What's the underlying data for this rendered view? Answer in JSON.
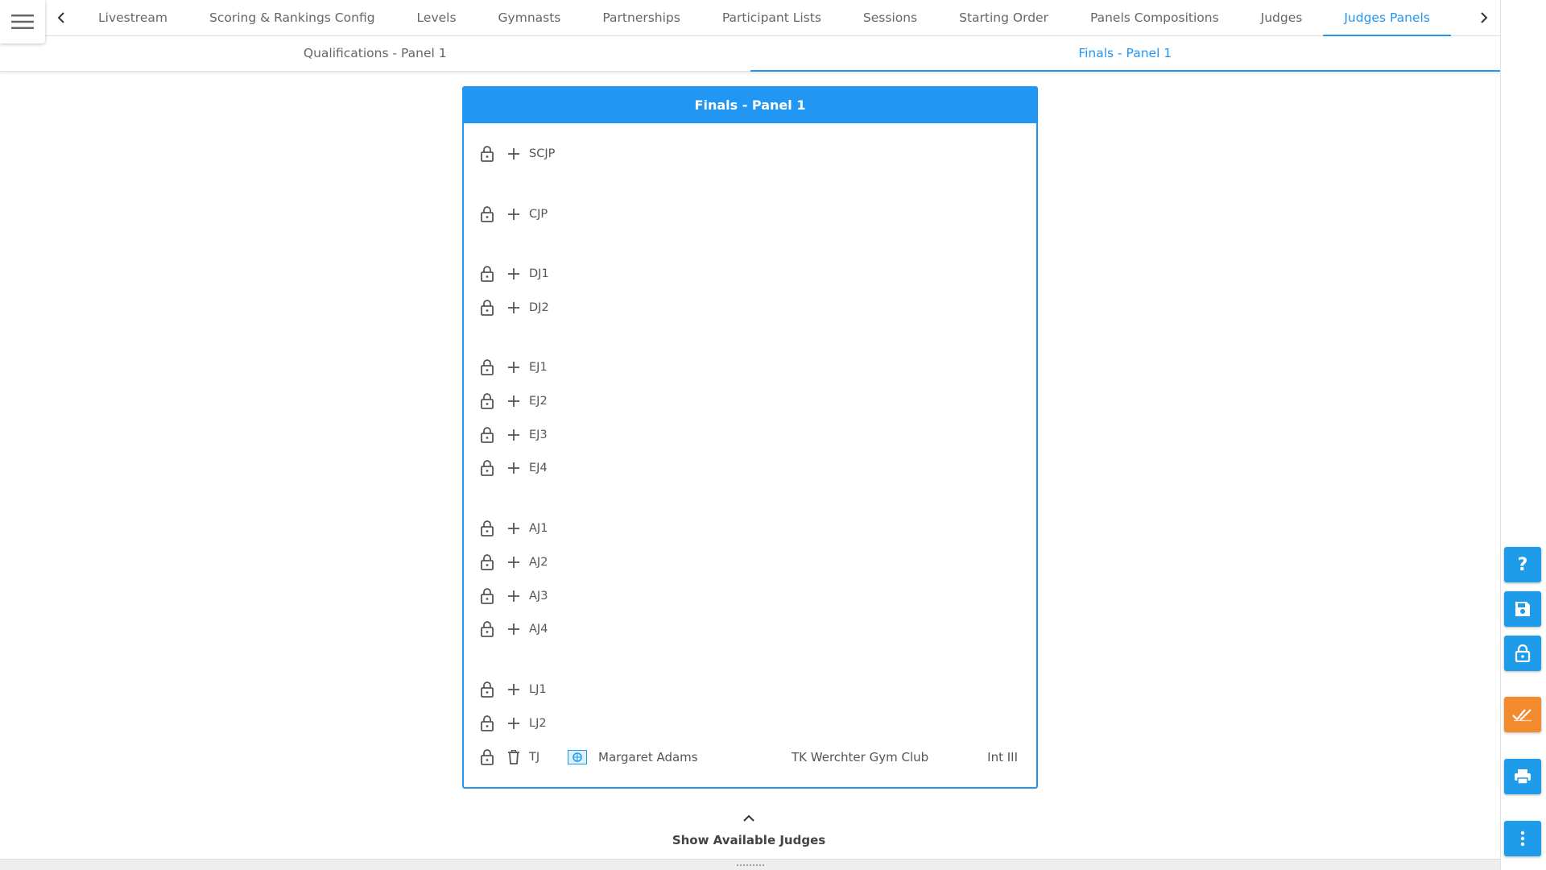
{
  "nav": {
    "tabs": [
      {
        "label": "Livestream"
      },
      {
        "label": "Scoring & Rankings Config"
      },
      {
        "label": "Levels"
      },
      {
        "label": "Gymnasts"
      },
      {
        "label": "Partnerships"
      },
      {
        "label": "Participant Lists"
      },
      {
        "label": "Sessions"
      },
      {
        "label": "Starting Order"
      },
      {
        "label": "Panels Compositions"
      },
      {
        "label": "Judges"
      },
      {
        "label": "Judges Panels"
      }
    ],
    "active_tab": "Judges Panels"
  },
  "subtabs": [
    {
      "label": "Qualifications - Panel 1"
    },
    {
      "label": "Finals - Panel 1"
    }
  ],
  "panel": {
    "title": "Finals - Panel 1",
    "roles": [
      {
        "label": "SCJP"
      },
      {
        "label": "CJP"
      },
      {
        "label": "DJ1"
      },
      {
        "label": "DJ2"
      },
      {
        "label": "EJ1"
      },
      {
        "label": "EJ2"
      },
      {
        "label": "EJ3"
      },
      {
        "label": "EJ4"
      },
      {
        "label": "AJ1"
      },
      {
        "label": "AJ2"
      },
      {
        "label": "AJ3"
      },
      {
        "label": "AJ4"
      },
      {
        "label": "LJ1"
      },
      {
        "label": "LJ2"
      },
      {
        "label": "TJ",
        "judge_name": "Margaret Adams",
        "club": "TK Werchter Gym Club",
        "level": "Int III"
      }
    ]
  },
  "show_available": {
    "label": "Show Available Judges"
  },
  "colors": {
    "accent": "#2196f3",
    "fab_blue": "#1e9be9",
    "fab_orange": "#f28a2e"
  }
}
